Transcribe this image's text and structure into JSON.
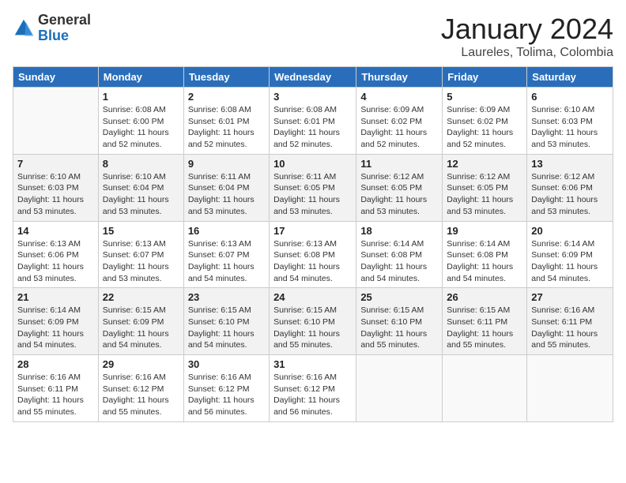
{
  "header": {
    "logo_general": "General",
    "logo_blue": "Blue",
    "month": "January 2024",
    "location": "Laureles, Tolima, Colombia"
  },
  "days_of_week": [
    "Sunday",
    "Monday",
    "Tuesday",
    "Wednesday",
    "Thursday",
    "Friday",
    "Saturday"
  ],
  "weeks": [
    [
      {
        "day": "",
        "info": ""
      },
      {
        "day": "1",
        "info": "Sunrise: 6:08 AM\nSunset: 6:00 PM\nDaylight: 11 hours\nand 52 minutes."
      },
      {
        "day": "2",
        "info": "Sunrise: 6:08 AM\nSunset: 6:01 PM\nDaylight: 11 hours\nand 52 minutes."
      },
      {
        "day": "3",
        "info": "Sunrise: 6:08 AM\nSunset: 6:01 PM\nDaylight: 11 hours\nand 52 minutes."
      },
      {
        "day": "4",
        "info": "Sunrise: 6:09 AM\nSunset: 6:02 PM\nDaylight: 11 hours\nand 52 minutes."
      },
      {
        "day": "5",
        "info": "Sunrise: 6:09 AM\nSunset: 6:02 PM\nDaylight: 11 hours\nand 52 minutes."
      },
      {
        "day": "6",
        "info": "Sunrise: 6:10 AM\nSunset: 6:03 PM\nDaylight: 11 hours\nand 53 minutes."
      }
    ],
    [
      {
        "day": "7",
        "info": "Sunrise: 6:10 AM\nSunset: 6:03 PM\nDaylight: 11 hours\nand 53 minutes."
      },
      {
        "day": "8",
        "info": "Sunrise: 6:10 AM\nSunset: 6:04 PM\nDaylight: 11 hours\nand 53 minutes."
      },
      {
        "day": "9",
        "info": "Sunrise: 6:11 AM\nSunset: 6:04 PM\nDaylight: 11 hours\nand 53 minutes."
      },
      {
        "day": "10",
        "info": "Sunrise: 6:11 AM\nSunset: 6:05 PM\nDaylight: 11 hours\nand 53 minutes."
      },
      {
        "day": "11",
        "info": "Sunrise: 6:12 AM\nSunset: 6:05 PM\nDaylight: 11 hours\nand 53 minutes."
      },
      {
        "day": "12",
        "info": "Sunrise: 6:12 AM\nSunset: 6:05 PM\nDaylight: 11 hours\nand 53 minutes."
      },
      {
        "day": "13",
        "info": "Sunrise: 6:12 AM\nSunset: 6:06 PM\nDaylight: 11 hours\nand 53 minutes."
      }
    ],
    [
      {
        "day": "14",
        "info": "Sunrise: 6:13 AM\nSunset: 6:06 PM\nDaylight: 11 hours\nand 53 minutes."
      },
      {
        "day": "15",
        "info": "Sunrise: 6:13 AM\nSunset: 6:07 PM\nDaylight: 11 hours\nand 53 minutes."
      },
      {
        "day": "16",
        "info": "Sunrise: 6:13 AM\nSunset: 6:07 PM\nDaylight: 11 hours\nand 54 minutes."
      },
      {
        "day": "17",
        "info": "Sunrise: 6:13 AM\nSunset: 6:08 PM\nDaylight: 11 hours\nand 54 minutes."
      },
      {
        "day": "18",
        "info": "Sunrise: 6:14 AM\nSunset: 6:08 PM\nDaylight: 11 hours\nand 54 minutes."
      },
      {
        "day": "19",
        "info": "Sunrise: 6:14 AM\nSunset: 6:08 PM\nDaylight: 11 hours\nand 54 minutes."
      },
      {
        "day": "20",
        "info": "Sunrise: 6:14 AM\nSunset: 6:09 PM\nDaylight: 11 hours\nand 54 minutes."
      }
    ],
    [
      {
        "day": "21",
        "info": "Sunrise: 6:14 AM\nSunset: 6:09 PM\nDaylight: 11 hours\nand 54 minutes."
      },
      {
        "day": "22",
        "info": "Sunrise: 6:15 AM\nSunset: 6:09 PM\nDaylight: 11 hours\nand 54 minutes."
      },
      {
        "day": "23",
        "info": "Sunrise: 6:15 AM\nSunset: 6:10 PM\nDaylight: 11 hours\nand 54 minutes."
      },
      {
        "day": "24",
        "info": "Sunrise: 6:15 AM\nSunset: 6:10 PM\nDaylight: 11 hours\nand 55 minutes."
      },
      {
        "day": "25",
        "info": "Sunrise: 6:15 AM\nSunset: 6:10 PM\nDaylight: 11 hours\nand 55 minutes."
      },
      {
        "day": "26",
        "info": "Sunrise: 6:15 AM\nSunset: 6:11 PM\nDaylight: 11 hours\nand 55 minutes."
      },
      {
        "day": "27",
        "info": "Sunrise: 6:16 AM\nSunset: 6:11 PM\nDaylight: 11 hours\nand 55 minutes."
      }
    ],
    [
      {
        "day": "28",
        "info": "Sunrise: 6:16 AM\nSunset: 6:11 PM\nDaylight: 11 hours\nand 55 minutes."
      },
      {
        "day": "29",
        "info": "Sunrise: 6:16 AM\nSunset: 6:12 PM\nDaylight: 11 hours\nand 55 minutes."
      },
      {
        "day": "30",
        "info": "Sunrise: 6:16 AM\nSunset: 6:12 PM\nDaylight: 11 hours\nand 56 minutes."
      },
      {
        "day": "31",
        "info": "Sunrise: 6:16 AM\nSunset: 6:12 PM\nDaylight: 11 hours\nand 56 minutes."
      },
      {
        "day": "",
        "info": ""
      },
      {
        "day": "",
        "info": ""
      },
      {
        "day": "",
        "info": ""
      }
    ]
  ]
}
